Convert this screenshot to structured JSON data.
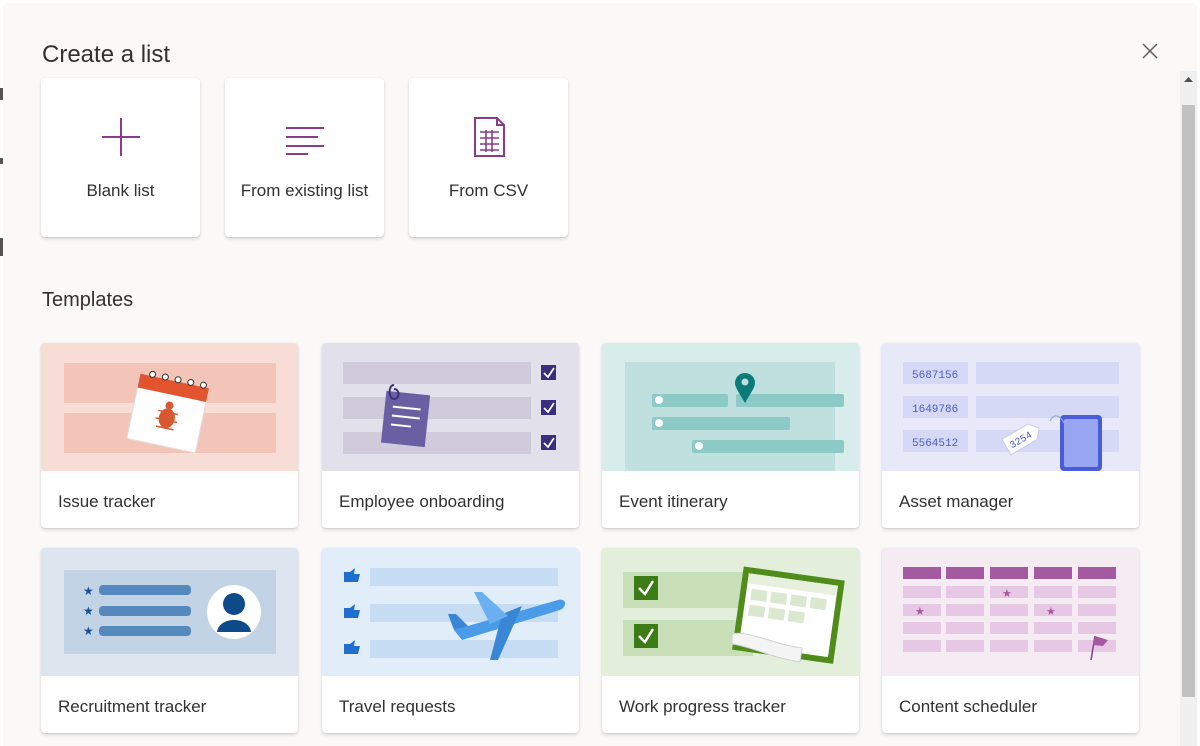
{
  "dialog": {
    "title": "Create a list"
  },
  "create_options": [
    {
      "label": "Blank list",
      "icon": "plus-icon"
    },
    {
      "label": "From existing list",
      "icon": "list-lines-icon"
    },
    {
      "label": "From CSV",
      "icon": "csv-document-icon"
    }
  ],
  "templates": {
    "title": "Templates",
    "items": [
      {
        "label": "Issue tracker"
      },
      {
        "label": "Employee onboarding"
      },
      {
        "label": "Event itinerary"
      },
      {
        "label": "Asset manager",
        "asset_ids": [
          "5687156",
          "1649786",
          "5564512"
        ],
        "tag_id": "3254"
      },
      {
        "label": "Recruitment tracker"
      },
      {
        "label": "Travel requests"
      },
      {
        "label": "Work progress tracker"
      },
      {
        "label": "Content scheduler"
      }
    ]
  },
  "colors": {
    "accent": "#8a3c8b",
    "dialog_bg": "#faf9f8",
    "text": "#323130"
  }
}
